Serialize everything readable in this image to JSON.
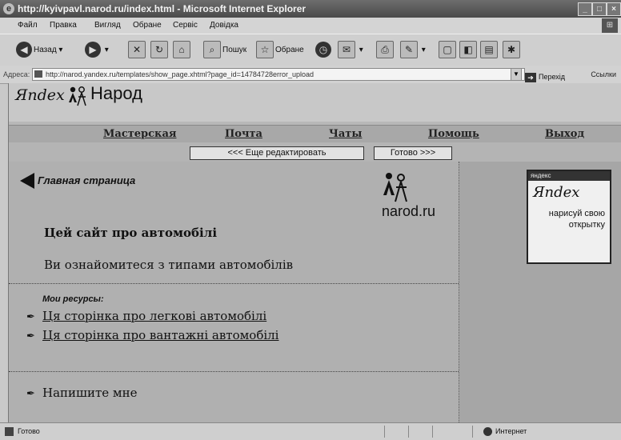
{
  "window": {
    "title": "http://kyivpavl.narod.ru/index.html - Microsoft Internet Explorer",
    "controls": [
      "_",
      "□",
      "×"
    ]
  },
  "menu": [
    "Файл",
    "Правка",
    "Вигляд",
    "Обране",
    "Сервіс",
    "Довідка"
  ],
  "toolbar": {
    "back": "Назад",
    "search": "Пошук",
    "favorites": "Обране"
  },
  "address": {
    "label": "Адреса:",
    "url": "http://narod.yandex.ru/templates/show_page.xhtml?page_id=14784728error_upload",
    "go": "Перехід",
    "links": "Ссылки"
  },
  "narod": {
    "yandex_logo": "Яndex",
    "brand": "Народ",
    "nav": [
      "Мастерская",
      "Почта",
      "Чаты",
      "Помощь",
      "Выход"
    ],
    "edit_button": "<<< Еще редактировать",
    "done_button": "Готово >>>"
  },
  "page": {
    "home": "Главная страница",
    "narodru": "narod.ru",
    "heading": "Цей сайт про автомобілі",
    "intro": "Ви ознайомитеся з типами автомобілів",
    "resources_title": "Мои ресурсы:",
    "links": [
      "Ця сторінка про легкові автомобілі",
      "Ця сторінка про вантажні автомобілі"
    ],
    "contact": "Напишите мне"
  },
  "ad": {
    "top": "яндекс",
    "logo": "Яndex",
    "text": "нарисуй свою открытку"
  },
  "status": {
    "text": "Готово",
    "zone": "Интернет"
  }
}
